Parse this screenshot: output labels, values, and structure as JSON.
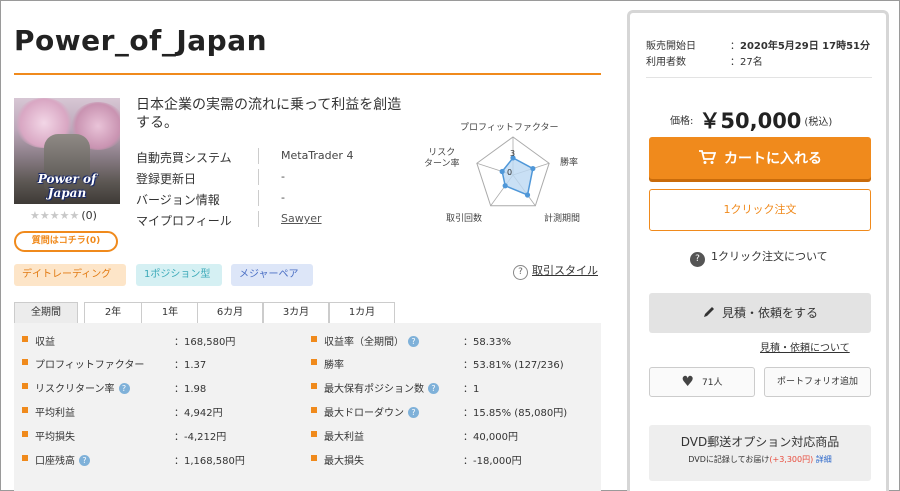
{
  "product": {
    "title": "Power_of_Japan",
    "thumb_caption": "Power of Japan",
    "stars": "★★★★★",
    "review_count": "(0)",
    "ask_button": "質問はコチラ(0)",
    "description": "日本企業の実需の流れに乗って利益を創造する。"
  },
  "specs": [
    {
      "label": "自動売買システム",
      "value": "MetaTrader 4"
    },
    {
      "label": "登録更新日",
      "value": "-"
    },
    {
      "label": "バージョン情報",
      "value": "-"
    },
    {
      "label": "マイプロフィール",
      "value": "Sawyer"
    }
  ],
  "radar": {
    "labels": {
      "pf": "プロフィットファクター",
      "winrate": "勝率",
      "period": "計測期間",
      "trades": "取引回数",
      "risk": "リスク\nターン率"
    },
    "scale_labels": [
      "3",
      "0"
    ],
    "values": {
      "pf": 0.45,
      "winrate": 0.55,
      "period": 0.65,
      "trades": 0.35,
      "risk": 0.3
    },
    "colors": {
      "grid": "#aaaaaa",
      "fill": "#bcd8f3",
      "stroke": "#4f97d8"
    }
  },
  "tags": [
    "デイトレーディング",
    "1ポジション型",
    "メジャーペア"
  ],
  "trade_style_link": "取引スタイル",
  "tabs": [
    "全期間",
    "2年",
    "1年",
    "6カ月",
    "3カ月",
    "1カ月"
  ],
  "stats_left": [
    {
      "label": "収益",
      "value": "168,580円",
      "help": false
    },
    {
      "label": "プロフィットファクター",
      "value": "1.37",
      "help": false
    },
    {
      "label": "リスクリターン率",
      "value": "1.98",
      "help": true
    },
    {
      "label": "平均利益",
      "value": "4,942円",
      "help": false
    },
    {
      "label": "平均損失",
      "value": "-4,212円",
      "help": false
    },
    {
      "label": "口座残高",
      "value": "1,168,580円",
      "help": true
    }
  ],
  "stats_right": [
    {
      "label": "収益率（全期間）",
      "value": "58.33%",
      "help": true
    },
    {
      "label": "勝率",
      "value": "53.81% (127/236)",
      "help": false
    },
    {
      "label": "最大保有ポジション数",
      "value": "1",
      "help": true
    },
    {
      "label": "最大ドローダウン",
      "value": "15.85% (85,080円)",
      "help": true
    },
    {
      "label": "最大利益",
      "value": "40,000円",
      "help": false
    },
    {
      "label": "最大損失",
      "value": "-18,000円",
      "help": false
    }
  ],
  "sidebar": {
    "sale_start_label": "販売開始日",
    "sale_start_value": "2020年5月29日 17時51分",
    "users_label": "利用者数",
    "users_value": "27名",
    "colon": "：",
    "price_label": "価格:",
    "price": "￥50,000",
    "tax": "(税込)",
    "cart_button": "カートに入れる",
    "oneclick_button": "1クリック注文",
    "oneclick_about": "1クリック注文について",
    "quote_button": "見積・依頼をする",
    "quote_about": "見積・依頼について",
    "fav_count": "71人",
    "portfolio_button": "ポートフォリオ追加",
    "dvd_title": "DVD郵送オプション対応商品",
    "dvd_text": "DVDに記録してお届け",
    "dvd_price": "(+3,300円)",
    "dvd_more": "詳細"
  },
  "colors": {
    "accent": "#f08a1c"
  }
}
